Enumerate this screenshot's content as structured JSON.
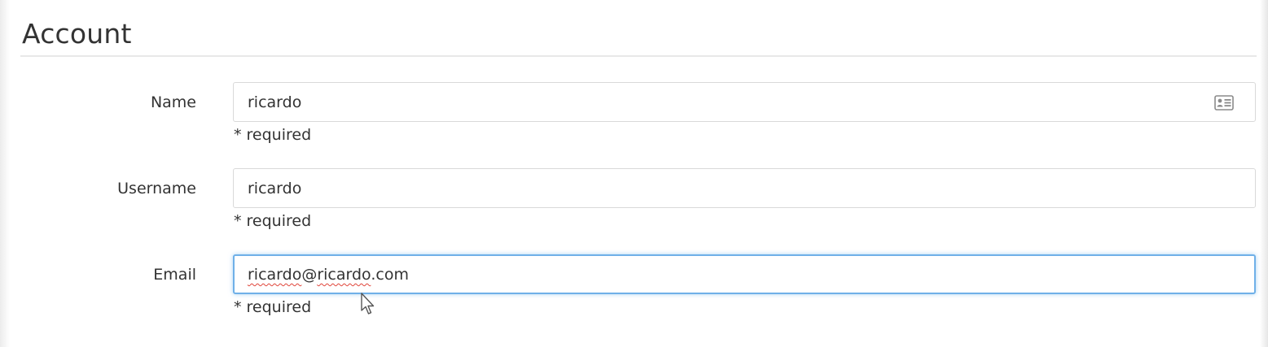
{
  "section": {
    "title": "Account"
  },
  "fields": {
    "name": {
      "label": "Name",
      "value": "ricardo",
      "hint": "* required",
      "icon": "contact-card-icon"
    },
    "username": {
      "label": "Username",
      "value": "ricardo",
      "hint": "* required"
    },
    "email": {
      "label": "Email",
      "value_user": "ricardo",
      "value_at": "@",
      "value_domain": "ricardo",
      "value_tld": ".com",
      "hint": "* required",
      "focused": true,
      "focus_color": "#6fb0e8"
    }
  },
  "colors": {
    "text": "#333333",
    "border": "#d9d9d9",
    "divider": "#e8e8e8",
    "spellcheck": "#e0453a"
  }
}
